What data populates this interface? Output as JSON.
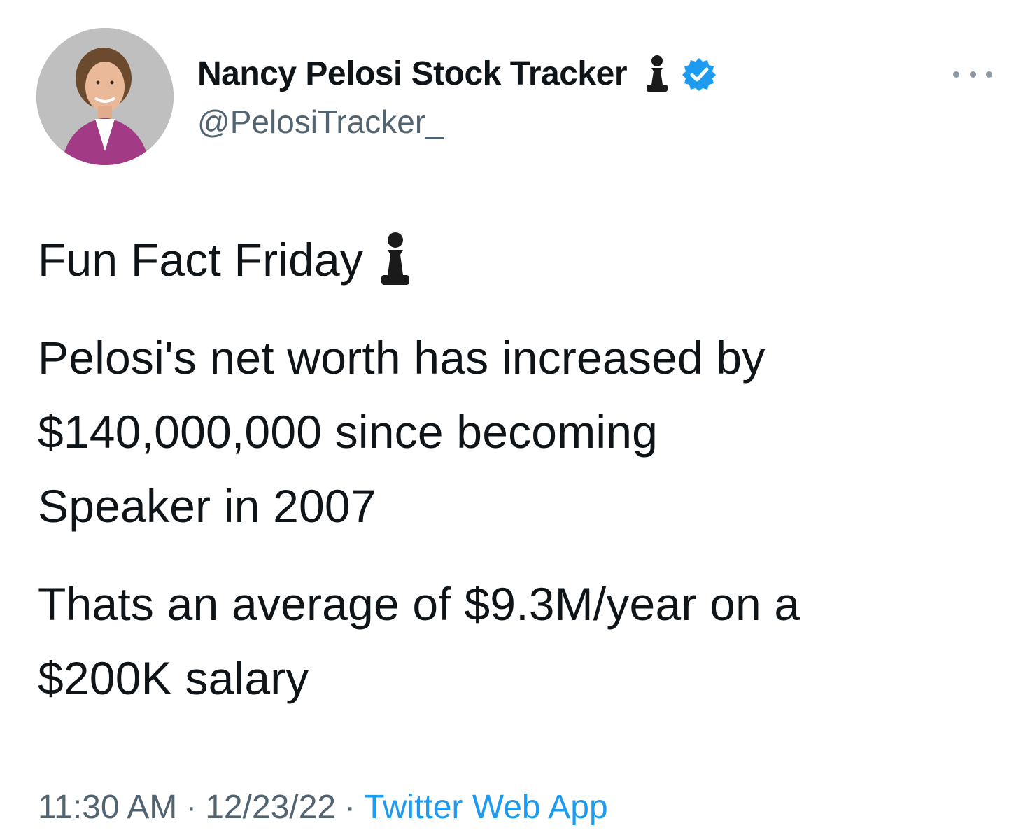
{
  "author": {
    "display_name": "Nancy Pelosi Stock Tracker",
    "handle": "@PelosiTracker_",
    "verified": true,
    "name_emoji_icon": "chess-pawn-icon"
  },
  "tweet": {
    "lines": [
      "Fun Fact Friday",
      "Pelosi's net worth has increased by",
      "$140,000,000 since becoming",
      "Speaker in 2007",
      "Thats an average of $9.3M/year on a",
      "$200K salary"
    ],
    "first_line_emoji_icon": "chess-pawn-icon"
  },
  "meta": {
    "time": "11:30 AM",
    "separator": "·",
    "date": "12/23/22",
    "source": "Twitter Web App"
  },
  "colors": {
    "text": "#0f1419",
    "secondary": "#536471",
    "accent": "#1d9bf0"
  }
}
